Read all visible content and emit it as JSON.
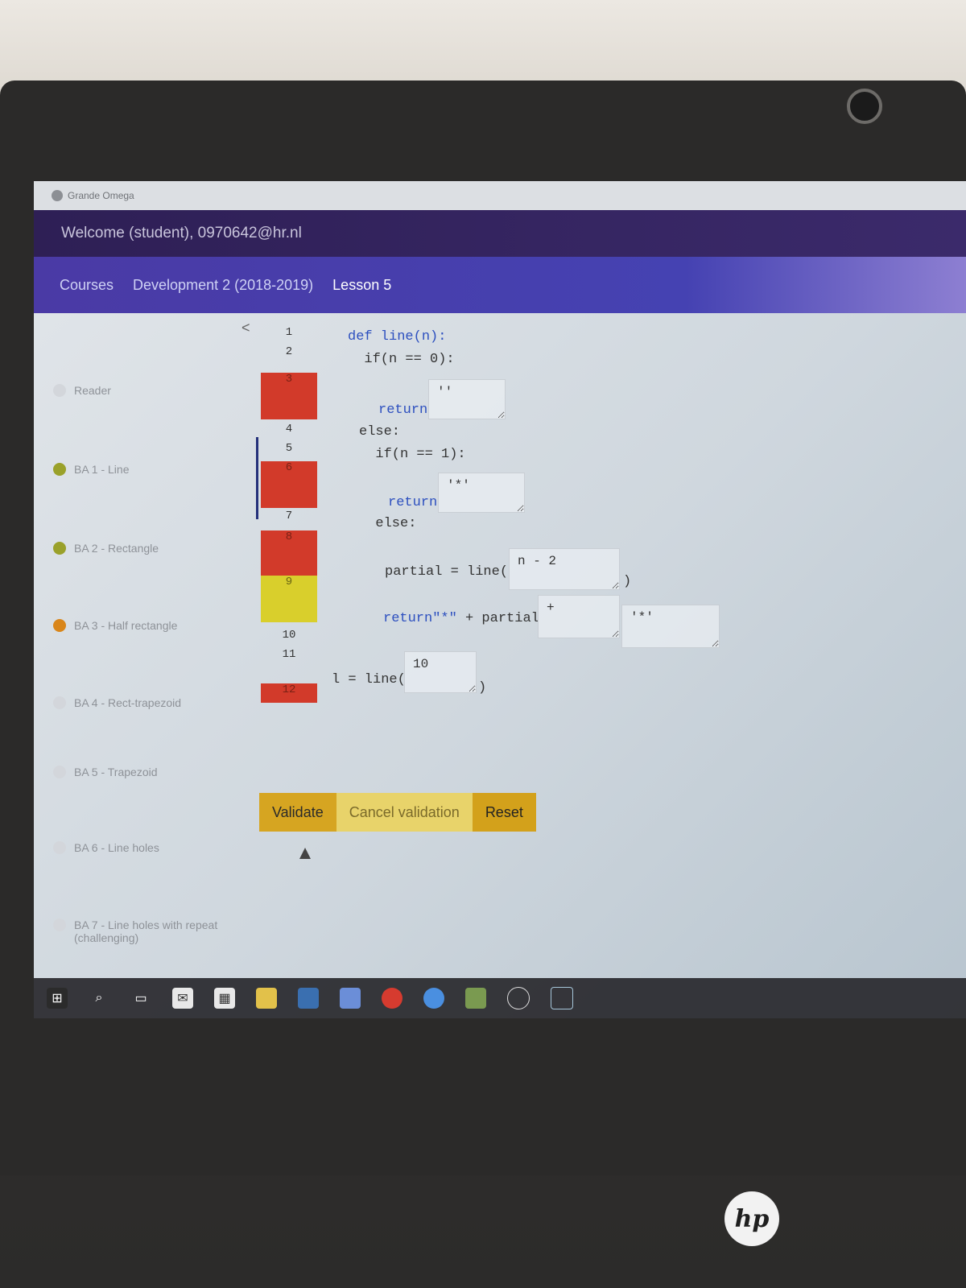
{
  "window": {
    "app_title": "Grande Omega"
  },
  "header": {
    "welcome": "Welcome (student), 0970642@hr.nl"
  },
  "nav": {
    "items": [
      {
        "label": "Courses"
      },
      {
        "label": "Development 2 (2018-2019)"
      },
      {
        "label": "Lesson 5"
      }
    ]
  },
  "sidebar": {
    "collapse": "<",
    "items": [
      {
        "label": "Reader",
        "status": "none"
      },
      {
        "label": "BA 1 - Line",
        "status": "partial"
      },
      {
        "label": "BA 2 - Rectangle",
        "status": "partial"
      },
      {
        "label": "BA 3 - Half rectangle",
        "status": "in-progress"
      },
      {
        "label": "BA 4 - Rect-trapezoid",
        "status": "none"
      },
      {
        "label": "BA 5 - Trapezoid",
        "status": "none"
      },
      {
        "label": "BA 6 - Line holes",
        "status": "none"
      },
      {
        "label": "BA 7 - Line holes with repeat (challenging)",
        "status": "none"
      }
    ]
  },
  "gutter": {
    "lines": [
      "1",
      "2",
      "3",
      "4",
      "5",
      "6",
      "7",
      "8",
      "9",
      "10",
      "11",
      "12"
    ],
    "states": [
      "none",
      "none",
      "error",
      "none",
      "none",
      "error",
      "none",
      "error",
      "warning",
      "none",
      "none",
      "error"
    ]
  },
  "code": {
    "l1": "def line(n):",
    "l2": "  if(n == 0):",
    "l3_kw": "return",
    "l4": "else:",
    "l5": "  if(n == 1):",
    "l6_kw": "return",
    "l7": "  else:",
    "l8a": "partial = line(",
    "l8b": ")",
    "l9_kw": "return",
    "l9_str": "\"*\"",
    "l9_rest": " + partial",
    "l12a": "l = line(",
    "l12b": ")"
  },
  "slots": {
    "s1": "''",
    "s2": "'*'",
    "s3": "n - 2",
    "s4": "+",
    "s5": "'*'",
    "s6": "10"
  },
  "buttons": {
    "validate": "Validate",
    "cancel": "Cancel validation",
    "reset": "Reset"
  },
  "taskbar": {
    "icons": [
      "windows-start-icon",
      "search-icon",
      "task-view-icon",
      "mail-icon",
      "calendar-icon",
      "file-explorer-icon",
      "python-icon",
      "notepad-icon",
      "pdf-icon",
      "chrome-icon",
      "notes-icon",
      "app-icon",
      "vscode-icon"
    ]
  },
  "brand": {
    "logo": "hp"
  }
}
